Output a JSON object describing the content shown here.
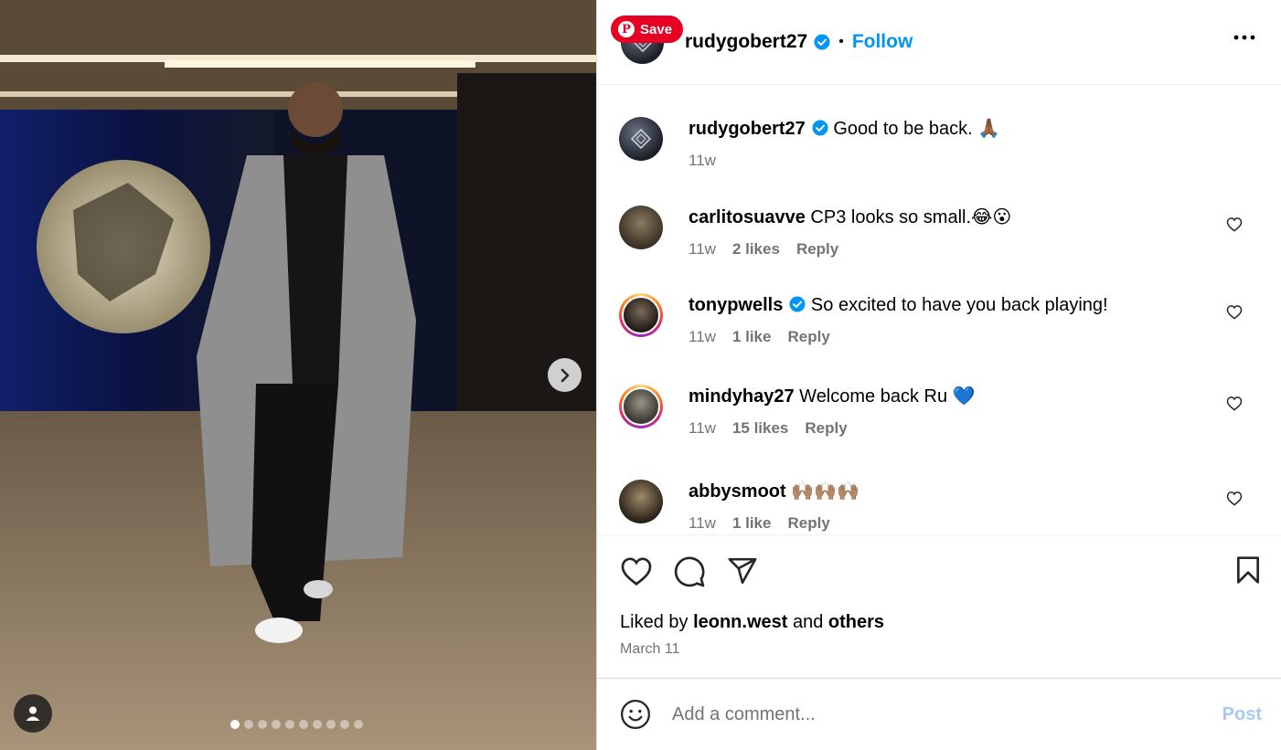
{
  "pin_save": {
    "label": "Save"
  },
  "media": {
    "carousel_total": 10,
    "carousel_active": 1
  },
  "post": {
    "author": "rudygobert27",
    "follow_label": "Follow",
    "caption": {
      "user": "rudygobert27",
      "text": "Good to be back. 🙏🏾",
      "time": "11w"
    },
    "comments": [
      {
        "user": "carlitosuavve",
        "text": "CP3 looks so small.😂😮",
        "time": "11w",
        "likes": "2 likes",
        "reply": "Reply",
        "verified": false
      },
      {
        "user": "tonypwells",
        "text": "So excited to have you back playing!",
        "time": "11w",
        "likes": "1 like",
        "reply": "Reply",
        "verified": true
      },
      {
        "user": "mindyhay27",
        "text": "Welcome back Ru 💙",
        "time": "11w",
        "likes": "15 likes",
        "reply": "Reply",
        "verified": false
      },
      {
        "user": "abbysmoot",
        "text": "🙌🏽🙌🏽🙌🏽",
        "time": "11w",
        "likes": "1 like",
        "reply": "Reply",
        "verified": false
      }
    ],
    "liked_by": {
      "prefix": "Liked by",
      "user": "leonn.west",
      "and": "and",
      "others": "others"
    },
    "date": "March 11"
  },
  "add_comment": {
    "placeholder": "Add a comment...",
    "post_label": "Post"
  },
  "colors": {
    "accent": "#0095f6",
    "pinterest": "#e60023",
    "muted": "#737373"
  },
  "icons": [
    "pinterest-icon",
    "verified-icon",
    "more-icon",
    "heart-icon",
    "comment-icon",
    "share-icon",
    "bookmark-icon",
    "emoji-icon",
    "chevron-right-icon",
    "user-icon"
  ]
}
